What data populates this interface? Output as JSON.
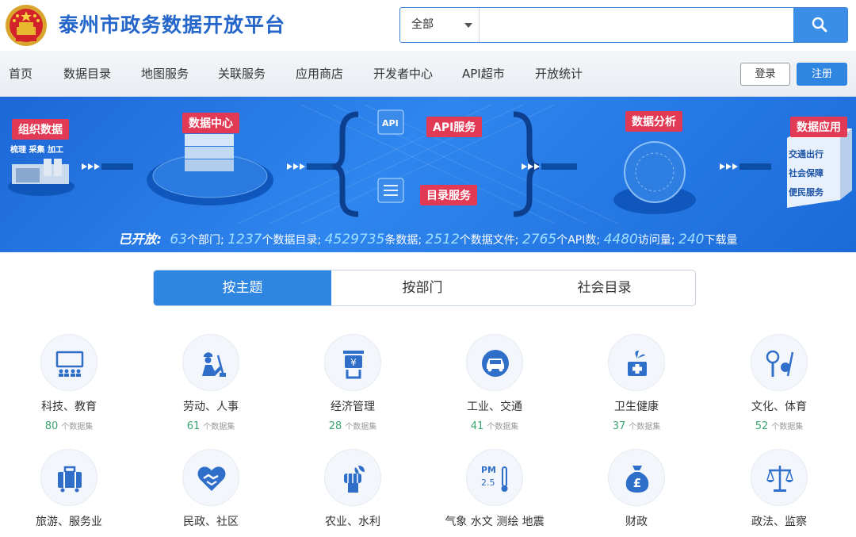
{
  "header": {
    "site_title": "泰州市政务数据开放平台",
    "search": {
      "scope": "全部",
      "placeholder": ""
    }
  },
  "nav": {
    "items": [
      "首页",
      "数据目录",
      "地图服务",
      "关联服务",
      "应用商店",
      "开发者中心",
      "API超市",
      "开放统计"
    ],
    "login": "登录",
    "register": "注册"
  },
  "banner": {
    "stage1": "组织数据",
    "stage1_sub": "梳理 采集 加工",
    "stage2": "数据中心",
    "api_badge": "API",
    "api_service": "API服务",
    "catalog_service": "目录服务",
    "stage3": "数据分析",
    "stage4": "数据应用",
    "app_items": [
      "交通出行",
      "社会保障",
      "便民服务"
    ],
    "stats": {
      "label": "已开放:",
      "items": [
        {
          "num": "63",
          "text": "个部门;"
        },
        {
          "num": "1237",
          "text": "个数据目录;"
        },
        {
          "num": "4529735",
          "text": "条数据;"
        },
        {
          "num": "2512",
          "text": "个数据文件;"
        },
        {
          "num": "2765",
          "text": "个API数;"
        },
        {
          "num": "4480",
          "text": "访问量;"
        },
        {
          "num": "240",
          "text": "下载量"
        }
      ]
    }
  },
  "tabs": [
    "按主题",
    "按部门",
    "社会目录"
  ],
  "categories": [
    {
      "name": "科技、教育",
      "count": "80",
      "unit": "个数据集",
      "icon": "classroom-icon"
    },
    {
      "name": "劳动、人事",
      "count": "61",
      "unit": "个数据集",
      "icon": "worker-icon"
    },
    {
      "name": "经济管理",
      "count": "28",
      "unit": "个数据集",
      "icon": "money-hand-icon"
    },
    {
      "name": "工业、交通",
      "count": "41",
      "unit": "个数据集",
      "icon": "car-icon"
    },
    {
      "name": "卫生健康",
      "count": "37",
      "unit": "个数据集",
      "icon": "medical-icon"
    },
    {
      "name": "文化、体育",
      "count": "52",
      "unit": "个数据集",
      "icon": "sports-icon"
    },
    {
      "name": "旅游、服务业",
      "icon": "luggage-icon"
    },
    {
      "name": "民政、社区",
      "icon": "heart-handshake-icon"
    },
    {
      "name": "农业、水利",
      "icon": "fist-wheat-icon"
    },
    {
      "name": "气象 水文 测绘 地震",
      "icon": "pm25-thermometer-icon",
      "icon_text": [
        "PM",
        "2.5"
      ]
    },
    {
      "name": "财政",
      "icon": "money-bag-icon"
    },
    {
      "name": "政法、监察",
      "icon": "scales-icon"
    }
  ],
  "colors": {
    "primary": "#2f86e0",
    "title": "#2466c9",
    "tag": "#e23a55",
    "count": "#3aa572",
    "icon": "#2f6fc9"
  }
}
